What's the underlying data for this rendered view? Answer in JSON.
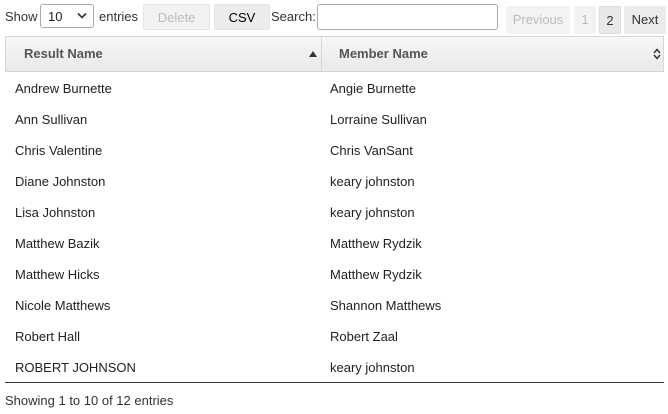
{
  "toolbar": {
    "show_label": "Show",
    "entries_value": "10",
    "entries_label": "entries",
    "delete_label": "Delete",
    "csv_label": "CSV",
    "search_label": "Search:",
    "search_value": ""
  },
  "pagination": {
    "previous": "Previous",
    "pages": [
      "1",
      "2"
    ],
    "next": "Next"
  },
  "table": {
    "columns": [
      "Result Name",
      "Member Name"
    ],
    "rows": [
      [
        "Andrew Burnette",
        "Angie Burnette"
      ],
      [
        "Ann Sullivan",
        "Lorraine Sullivan"
      ],
      [
        "Chris Valentine",
        "Chris VanSant"
      ],
      [
        "Diane Johnston",
        "keary johnston"
      ],
      [
        "Lisa Johnston",
        "keary johnston"
      ],
      [
        "Matthew Bazik",
        "Matthew Rydzik"
      ],
      [
        "Matthew Hicks",
        "Matthew Rydzik"
      ],
      [
        "Nicole Matthews",
        "Shannon Matthews"
      ],
      [
        "Robert Hall",
        "Robert Zaal"
      ],
      [
        "ROBERT JOHNSON",
        "keary johnston"
      ]
    ]
  },
  "info": "Showing 1 to 10 of 12 entries",
  "icons": {
    "entries_dropdown": "chevron-down-icon",
    "sort_result": "sort-ascending-icon",
    "sort_member": "sort-both-icon"
  },
  "colors": {
    "header_bg": "#ececec",
    "border": "#d6d6d6",
    "disabled_text": "#bbbbbb"
  }
}
